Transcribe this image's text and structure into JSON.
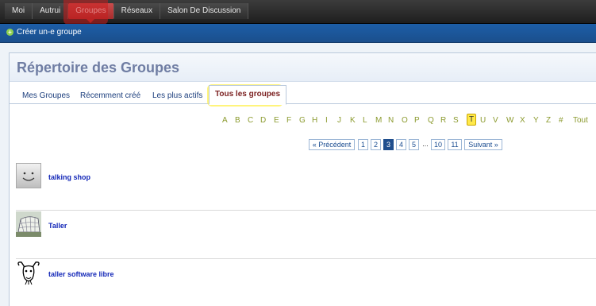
{
  "topnav": {
    "items": [
      "Moi",
      "Autrui",
      "Groupes",
      "Réseaux",
      "Salon De Discussion"
    ],
    "active_index": 2
  },
  "subnav": {
    "create_label": "Créer un-e groupe"
  },
  "page": {
    "title": "Répertoire des Groupes"
  },
  "tabs": {
    "items": [
      "Mes Groupes",
      "Récemment créé",
      "Les plus actifs",
      "Tous les groupes"
    ],
    "active_index": 3
  },
  "alphabet": {
    "letters": [
      "A",
      "B",
      "C",
      "D",
      "E",
      "F",
      "G",
      "H",
      "I",
      "J",
      "K",
      "L",
      "M",
      "N",
      "O",
      "P",
      "Q",
      "R",
      "S",
      "T",
      "U",
      "V",
      "W",
      "X",
      "Y",
      "Z",
      "#",
      "Tout"
    ],
    "selected": "T"
  },
  "pagination": {
    "prev_label": "« Précédent",
    "pages": [
      "1",
      "2",
      "3",
      "4",
      "5",
      "...",
      "10",
      "11"
    ],
    "current": "3",
    "next_label": "Suivant »"
  },
  "groups": [
    {
      "name": "talking shop",
      "icon": "smiley-icon"
    },
    {
      "name": "Taller",
      "icon": "building-photo"
    },
    {
      "name": "taller software libre",
      "icon": "gnu-logo"
    }
  ],
  "colors": {
    "topbar": "#2b2b2b",
    "active_nav": "#c94c4c",
    "subnav": "#1c5ea8",
    "title": "#6f7da3",
    "link": "#1428b8",
    "highlight_yellow": "#ffe94a"
  }
}
